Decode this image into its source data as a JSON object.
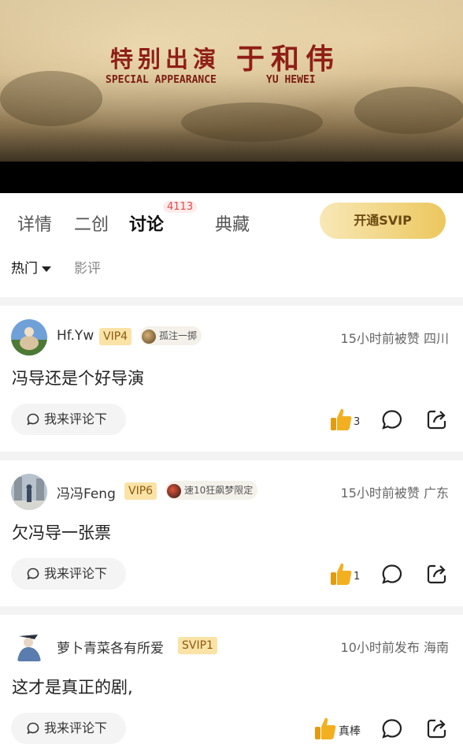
{
  "banner": {
    "title_cn": "特别出演",
    "name_cn": "于和伟",
    "title_en": "SPECIAL APPEARANCE",
    "name_en": "YU HEWEI"
  },
  "tabs": {
    "items": [
      {
        "label": "详情"
      },
      {
        "label": "二创"
      },
      {
        "label": "讨论",
        "badge": "4113"
      },
      {
        "label": "典藏"
      }
    ],
    "active": "讨论",
    "svip_button": "开通SVIP"
  },
  "filters": {
    "hot": "热门",
    "review": "影评"
  },
  "comments": [
    {
      "username": "Hf.Yw",
      "vip": "VIP4",
      "medal": "孤注一掷",
      "meta": "15小时前被赞  四川",
      "content": "冯导还是个好导演",
      "reply_label": "我来评论下",
      "likes": "3"
    },
    {
      "username": "冯冯Feng",
      "vip": "VIP6",
      "medal": "速10狂飙梦限定",
      "meta": "15小时前被赞  广东",
      "content": "欠冯导一张票",
      "reply_label": "我来评论下",
      "likes": "1"
    },
    {
      "username": "萝卜青菜各有所爱",
      "vip": "SVIP1",
      "meta": "10小时前发布  海南",
      "content": "这才是真正的剧,",
      "reply_label": "我来评论下",
      "likes": "真棒"
    }
  ],
  "colors": {
    "accent_gold": "#ecc75e",
    "badge_red": "#e24a4a",
    "thumb_yellow": "#f2b021"
  }
}
